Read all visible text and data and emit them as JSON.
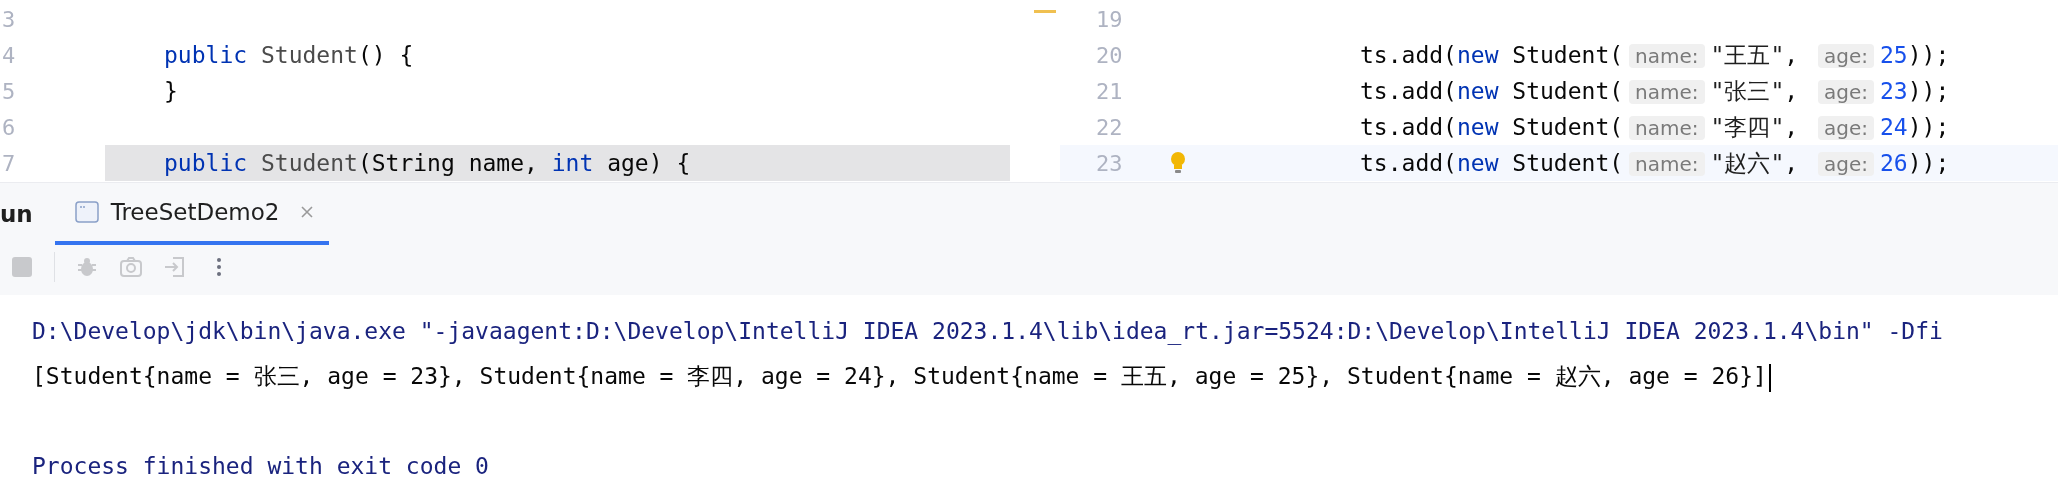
{
  "editor_left": {
    "lines": [
      {
        "number": "3",
        "highlighted": false
      },
      {
        "number": "4",
        "highlighted": false,
        "segments": [
          {
            "kind": "keyword",
            "text": "public"
          },
          {
            "kind": "name",
            "text": " Student"
          },
          {
            "kind": "plain",
            "text": "() {"
          }
        ]
      },
      {
        "number": "5",
        "highlighted": false,
        "segments": [
          {
            "kind": "plain",
            "text": "}"
          }
        ]
      },
      {
        "number": "6",
        "highlighted": false
      },
      {
        "number": "7",
        "highlighted": true,
        "segments": [
          {
            "kind": "keyword",
            "text": "public"
          },
          {
            "kind": "name",
            "text": " Student"
          },
          {
            "kind": "plain",
            "text": "(String name, "
          },
          {
            "kind": "keyword",
            "text": "int"
          },
          {
            "kind": "plain",
            "text": " age) {"
          }
        ]
      }
    ]
  },
  "editor_right": {
    "lines": [
      {
        "number": "19",
        "current": false,
        "bulb": false
      },
      {
        "number": "20",
        "current": false,
        "bulb": false,
        "segments": [
          {
            "kind": "plain",
            "text": "ts.add("
          },
          {
            "kind": "keyword",
            "text": "new"
          },
          {
            "kind": "plain",
            "text": " Student("
          },
          {
            "kind": "hint",
            "text": "name:"
          },
          {
            "kind": "string",
            "text": "\"王五\""
          },
          {
            "kind": "plain",
            "text": ", "
          },
          {
            "kind": "hint",
            "text": "age:"
          },
          {
            "kind": "number",
            "text": "25"
          },
          {
            "kind": "plain",
            "text": "));"
          }
        ]
      },
      {
        "number": "21",
        "current": false,
        "bulb": false,
        "segments": [
          {
            "kind": "plain",
            "text": "ts.add("
          },
          {
            "kind": "keyword",
            "text": "new"
          },
          {
            "kind": "plain",
            "text": " Student("
          },
          {
            "kind": "hint",
            "text": "name:"
          },
          {
            "kind": "string",
            "text": "\"张三\""
          },
          {
            "kind": "plain",
            "text": ", "
          },
          {
            "kind": "hint",
            "text": "age:"
          },
          {
            "kind": "number",
            "text": "23"
          },
          {
            "kind": "plain",
            "text": "));"
          }
        ]
      },
      {
        "number": "22",
        "current": false,
        "bulb": false,
        "segments": [
          {
            "kind": "plain",
            "text": "ts.add("
          },
          {
            "kind": "keyword",
            "text": "new"
          },
          {
            "kind": "plain",
            "text": " Student("
          },
          {
            "kind": "hint",
            "text": "name:"
          },
          {
            "kind": "string",
            "text": "\"李四\""
          },
          {
            "kind": "plain",
            "text": ", "
          },
          {
            "kind": "hint",
            "text": "age:"
          },
          {
            "kind": "number",
            "text": "24"
          },
          {
            "kind": "plain",
            "text": "));"
          }
        ]
      },
      {
        "number": "23",
        "current": true,
        "bulb": true,
        "segments": [
          {
            "kind": "plain",
            "text": "ts.add("
          },
          {
            "kind": "keyword",
            "text": "new"
          },
          {
            "kind": "plain",
            "text": " Student("
          },
          {
            "kind": "hint",
            "text": "name:"
          },
          {
            "kind": "string",
            "text": "\"赵六\""
          },
          {
            "kind": "plain",
            "text": ", "
          },
          {
            "kind": "hint",
            "text": "age:"
          },
          {
            "kind": "number",
            "text": "26"
          },
          {
            "kind": "plain",
            "text": "));"
          }
        ]
      }
    ]
  },
  "run_window": {
    "title": "un",
    "tabs": [
      {
        "label": "TreeSetDemo2",
        "selected": true
      }
    ],
    "console": [
      {
        "kind": "system",
        "text": "D:\\Develop\\jdk\\bin\\java.exe \"-javaagent:D:\\Develop\\IntelliJ IDEA 2023.1.4\\lib\\idea_rt.jar=5524:D:\\Develop\\IntelliJ IDEA 2023.1.4\\bin\" -Dfi"
      },
      {
        "kind": "output",
        "text": "[Student{name = 张三, age = 23}, Student{name = 李四, age = 24}, Student{name = 王五, age = 25}, Student{name = 赵六, age = 26}]",
        "caret": true
      },
      {
        "kind": "blank"
      },
      {
        "kind": "system",
        "text": "Process finished with exit code 0"
      }
    ]
  }
}
